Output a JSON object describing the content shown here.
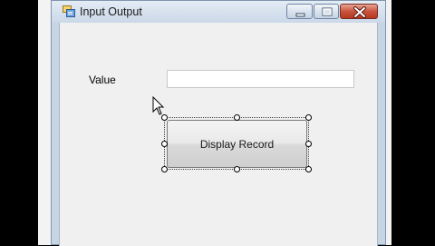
{
  "window": {
    "title": "Input Output",
    "icon": "form-icon"
  },
  "controls": {
    "minimize": "minimize-icon",
    "maximize": "maximize-icon",
    "close": "close-icon"
  },
  "form": {
    "value_label": "Value",
    "value_input": "",
    "button_label": "Display Record"
  },
  "colors": {
    "close_button": "#c9543e",
    "titlebar": "#cad8e8"
  }
}
